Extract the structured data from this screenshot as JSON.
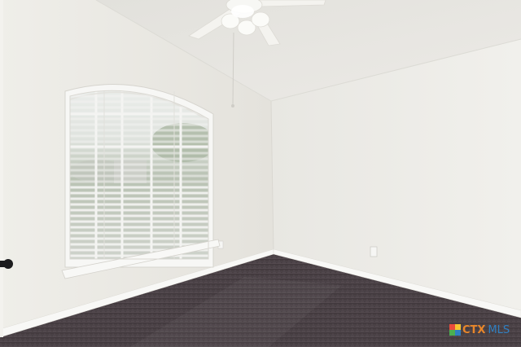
{
  "watermark": {
    "brand": "CTX",
    "suffix": "MLS",
    "brand_color": "#e8862a",
    "suffix_color": "#2f7fc1",
    "logo_colors": [
      "#e94b3c",
      "#f5c431",
      "#4caf50",
      "#2f7fc1"
    ]
  },
  "palette": {
    "left_wall": "#ecebe6",
    "right_wall": "#eeede9",
    "ceiling": "#e6e5e0",
    "carpet": "#4b4247",
    "baseboard": "#f6f6f3",
    "window_frame": "#f7f7f5",
    "blind_slat": "#f3f3f1",
    "outdoor_sky": "#e9ebe8",
    "outdoor_trees": "#a9b5a1"
  }
}
